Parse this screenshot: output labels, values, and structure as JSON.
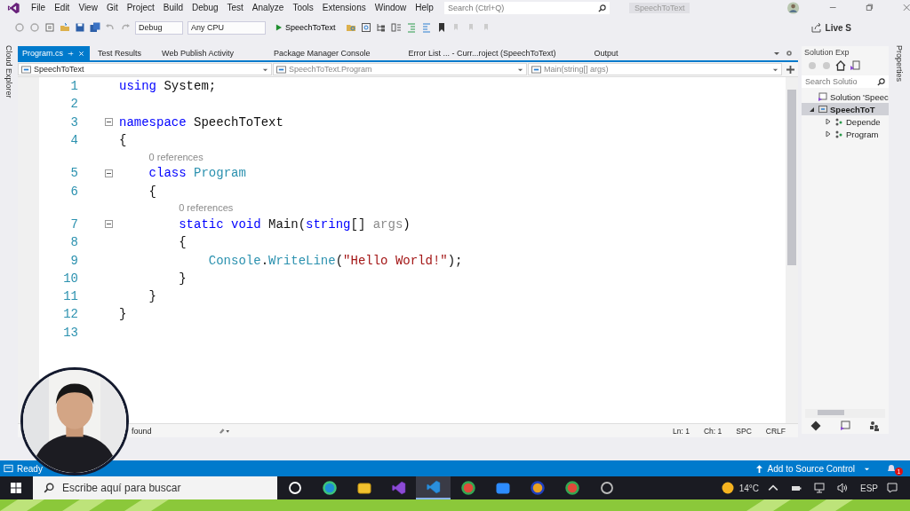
{
  "menu": [
    "File",
    "Edit",
    "View",
    "Git",
    "Project",
    "Build",
    "Debug",
    "Test",
    "Analyze",
    "Tools",
    "Extensions",
    "Window",
    "Help"
  ],
  "search": {
    "placeholder": "Search (Ctrl+Q)"
  },
  "solution_name": "SpeechToText",
  "toolbar": {
    "configuration": "Debug",
    "platform": "Any CPU",
    "start": "SpeechToText",
    "live_share": "Live S"
  },
  "side_tabs": {
    "left": "Cloud Explorer",
    "right": "Properties"
  },
  "tabs": [
    {
      "label": "Program.cs",
      "selected": true
    },
    {
      "label": "Test Results",
      "selected": false
    },
    {
      "label": "Web Publish Activity",
      "selected": false
    },
    {
      "label": "Package Manager Console",
      "selected": false
    },
    {
      "label": "Error List ... - Curr...roject (SpeechToText)",
      "selected": false
    },
    {
      "label": "Output",
      "selected": false
    }
  ],
  "navigation": [
    "SpeechToText",
    "SpeechToText.Program",
    "Main(string[] args)"
  ],
  "code": [
    {
      "kind": "code",
      "number": "1",
      "fold": false,
      "tokens": [
        {
          "kind": "keyword",
          "text": "using"
        },
        {
          "kind": "plain",
          "text": " System;"
        }
      ]
    },
    {
      "kind": "code",
      "number": "2",
      "fold": false
    },
    {
      "kind": "code",
      "number": "3",
      "fold": true,
      "tokens": [
        {
          "kind": "keyword",
          "text": "namespace"
        },
        {
          "kind": "plain",
          "text": " SpeechToText"
        }
      ]
    },
    {
      "kind": "code",
      "number": "4",
      "fold": false,
      "tokens": [
        {
          "kind": "plain",
          "text": "{"
        }
      ]
    },
    {
      "kind": "lens",
      "text": "0 references"
    },
    {
      "kind": "code",
      "number": "5",
      "fold": true,
      "tokens": [
        {
          "kind": "keyword",
          "text": "    class"
        },
        {
          "kind": "type",
          "text": " Program"
        }
      ]
    },
    {
      "kind": "code",
      "number": "6",
      "fold": false,
      "tokens": [
        {
          "kind": "plain",
          "text": "    {"
        }
      ]
    },
    {
      "kind": "lens",
      "text": "0 references"
    },
    {
      "kind": "code",
      "number": "7",
      "fold": true,
      "tokens": [
        {
          "kind": "keyword",
          "text": "        static"
        },
        {
          "kind": "keyword",
          "text": " void"
        },
        {
          "kind": "plain",
          "text": " Main("
        },
        {
          "kind": "keyword",
          "text": "string"
        },
        {
          "kind": "plain",
          "text": "[] "
        },
        {
          "kind": "unused",
          "text": "args"
        },
        {
          "kind": "plain",
          "text": ")"
        }
      ]
    },
    {
      "kind": "code",
      "number": "8",
      "fold": false,
      "tokens": [
        {
          "kind": "plain",
          "text": "        {"
        }
      ]
    },
    {
      "kind": "code",
      "number": "9",
      "fold": false,
      "tokens": [
        {
          "kind": "type",
          "text": "            Console"
        },
        {
          "kind": "plain",
          "text": "."
        },
        {
          "kind": "method",
          "text": "WriteLine"
        },
        {
          "kind": "plain",
          "text": "("
        },
        {
          "kind": "string",
          "text": "\"Hello World!\""
        },
        {
          "kind": "plain",
          "text": ");"
        }
      ]
    },
    {
      "kind": "code",
      "number": "10",
      "fold": false,
      "tokens": [
        {
          "kind": "plain",
          "text": "        }"
        }
      ]
    },
    {
      "kind": "code",
      "number": "11",
      "fold": false,
      "tokens": [
        {
          "kind": "plain",
          "text": "    }"
        }
      ]
    },
    {
      "kind": "code",
      "number": "12",
      "fold": false,
      "tokens": [
        {
          "kind": "plain",
          "text": "}"
        }
      ]
    },
    {
      "kind": "code",
      "number": "13",
      "fold": false
    }
  ],
  "editor_status": {
    "issues": "found",
    "line": "Ln: 1",
    "column": "Ch: 1",
    "whitespace": "SPC",
    "line_ending": "CRLF"
  },
  "solution_explorer": {
    "title": "Solution Exp",
    "search_placeholder": "Search Solutio",
    "tree": [
      {
        "label": "Solution 'Speec",
        "children": [
          {
            "label": "SpeechToT",
            "selected": true,
            "expanded": true,
            "children": [
              {
                "label": "Depende",
                "selected": false,
                "expanded": false
              },
              {
                "label": "Program",
                "selected": false,
                "expanded": false
              }
            ]
          }
        ]
      }
    ]
  },
  "status_bar": {
    "state": "Ready",
    "source_control": "Add to Source Control",
    "notifications": "1"
  },
  "taskbar": {
    "search_placeholder": "Escribe aquí para buscar",
    "apps": [
      {
        "kind": "cortana",
        "selected": false
      },
      {
        "kind": "edge",
        "selected": false
      },
      {
        "kind": "folder",
        "selected": false
      },
      {
        "kind": "studio",
        "selected": false
      },
      {
        "kind": "code",
        "selected": true
      },
      {
        "kind": "chrome",
        "selected": false
      },
      {
        "kind": "video",
        "selected": false
      },
      {
        "kind": "badge",
        "selected": false
      },
      {
        "kind": "chrome",
        "selected": false
      },
      {
        "kind": "recorder",
        "selected": false
      }
    ],
    "temperature": "14°C",
    "language": "ESP"
  }
}
